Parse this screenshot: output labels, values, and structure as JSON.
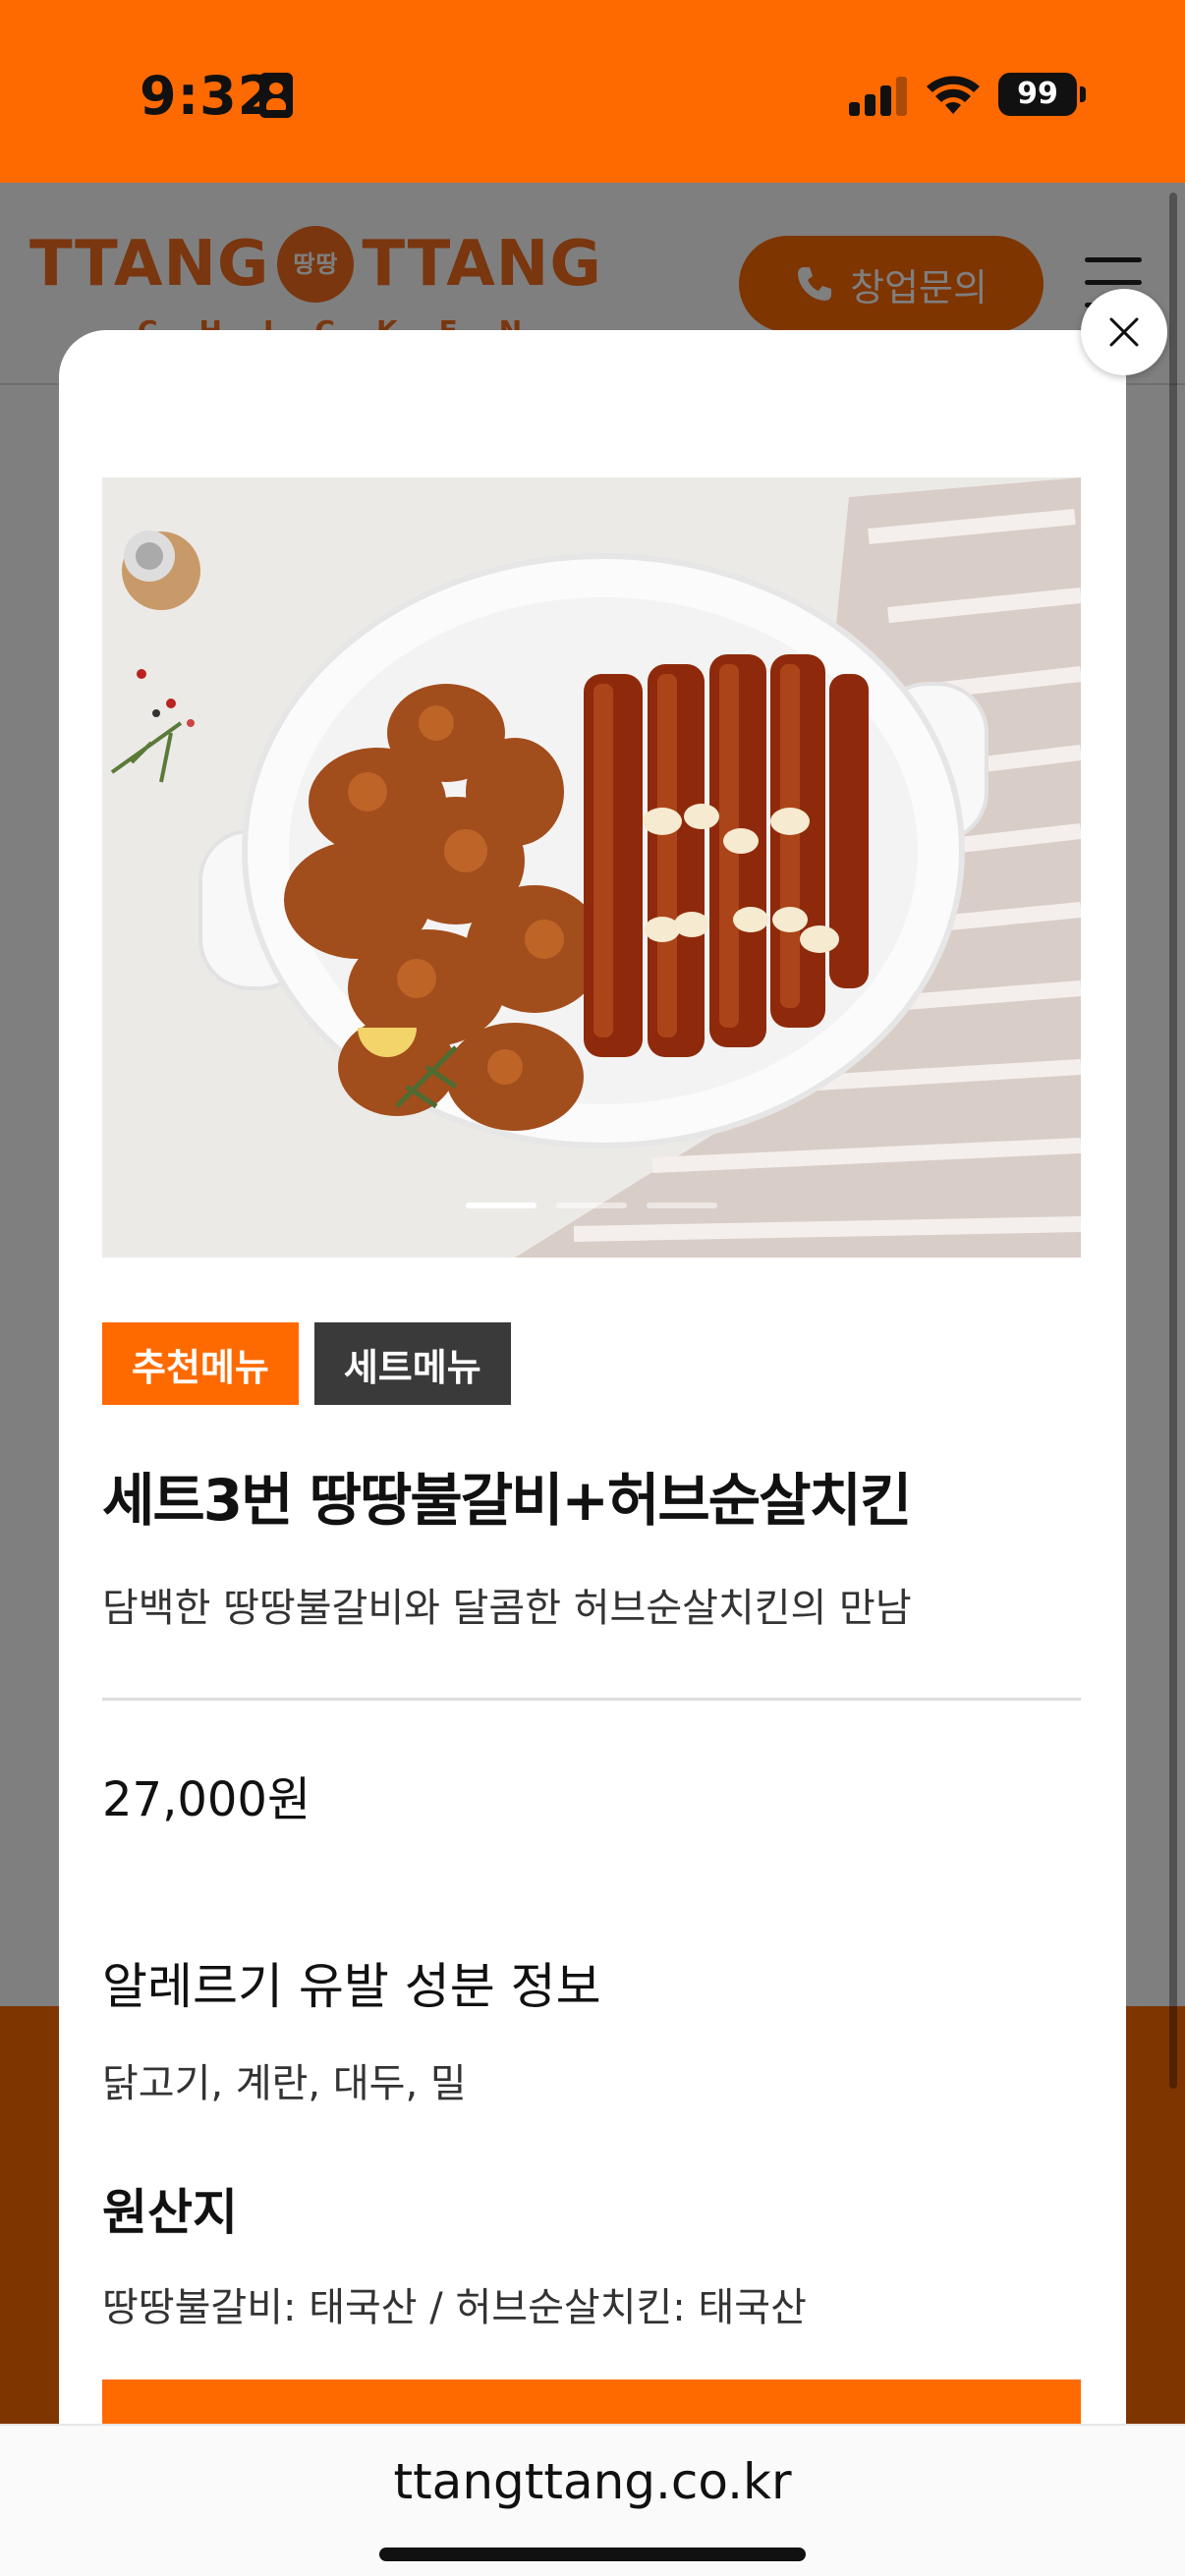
{
  "status_bar": {
    "time": "9:32",
    "battery": "99",
    "bg_color": "#ff6a00"
  },
  "header": {
    "logo_left": "TTANG",
    "logo_badge": "땅땅",
    "logo_right": "TTANG",
    "logo_sub": "CHICKEN",
    "inquiry_label": "창업문의",
    "brand_color": "#ff6a00"
  },
  "modal": {
    "close_icon": "close-icon",
    "tags": [
      {
        "label": "추천메뉴",
        "color": "#ff6a00"
      },
      {
        "label": "세트메뉴",
        "color": "#3a3a3a"
      }
    ],
    "title": "세트3번 땅땅불갈비+허브순살치킨",
    "description": "담백한 땅땅불갈비와 달콤한 허브순살치킨의 만남",
    "price": "27,000원",
    "allergy_heading": "알레르기 유발 성분 정보",
    "allergy_text": "닭고기, 계란, 대두, 밀",
    "origin_heading": "원산지",
    "origin_text": "땅땅불갈비: 태국산 / 허브순살치킨: 태국산",
    "carousel_count": 3,
    "carousel_active": 1
  },
  "browser": {
    "url": "ttangttang.co.kr"
  }
}
